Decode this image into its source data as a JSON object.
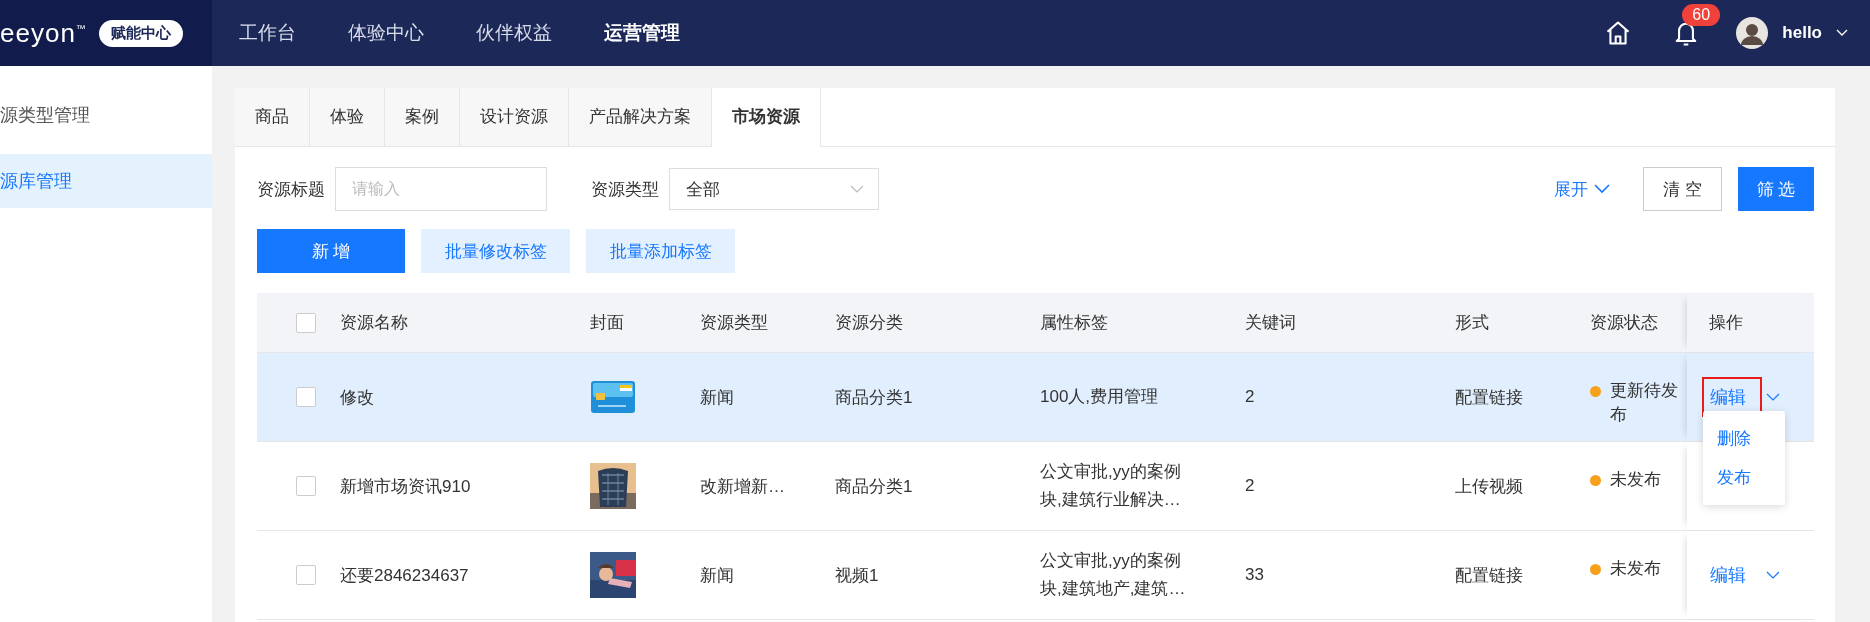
{
  "header": {
    "logo": "eeyon",
    "logo_mark": "™",
    "badge": "赋能中心",
    "nav": [
      {
        "label": "工作台",
        "selected": false
      },
      {
        "label": "体验中心",
        "selected": false
      },
      {
        "label": "伙伴权益",
        "selected": false
      },
      {
        "label": "运营管理",
        "selected": true
      }
    ],
    "notification_count": "60",
    "user": "hello"
  },
  "sidebar": {
    "items": [
      {
        "label": "源类型管理",
        "selected": false
      },
      {
        "label": "源库管理",
        "selected": true
      }
    ]
  },
  "tabs": [
    {
      "label": "商品",
      "selected": false
    },
    {
      "label": "体验",
      "selected": false
    },
    {
      "label": "案例",
      "selected": false
    },
    {
      "label": "设计资源",
      "selected": false
    },
    {
      "label": "产品解决方案",
      "selected": false
    },
    {
      "label": "市场资源",
      "selected": true
    }
  ],
  "filters": {
    "title_label": "资源标题",
    "title_placeholder": "请输入",
    "type_label": "资源类型",
    "type_value": "全部",
    "expand": "展开",
    "clear": "清 空",
    "submit": "筛 选"
  },
  "actions": [
    {
      "label": "新 增",
      "kind": "primary"
    },
    {
      "label": "批量修改标签",
      "kind": "light"
    },
    {
      "label": "批量添加标签",
      "kind": "light"
    }
  ],
  "table": {
    "all_checked": false,
    "columns": [
      "资源名称",
      "封面",
      "资源类型",
      "资源分类",
      "属性标签",
      "关键词",
      "形式",
      "资源状态",
      "操作"
    ],
    "rows": [
      {
        "checked": false,
        "selected": true,
        "name": "修改",
        "cover": {
          "kind": "icon"
        },
        "type": "新闻",
        "category": "商品分类1",
        "tags": "100人,费用管理",
        "keywords": "2",
        "form": "配置链接",
        "status": "更新待发布",
        "color": "#f7a01c",
        "action": {
          "label": "编辑",
          "highlighted": true,
          "menu": [
            "删除",
            "发布"
          ]
        }
      },
      {
        "checked": false,
        "selected": false,
        "name": "新增市场资讯910",
        "type": "改新增新…",
        "category": "商品分类1",
        "tags": "公文审批,yy的案例块,建筑行业解决…",
        "keywords": "2",
        "form": "上传视频",
        "status": "未发布",
        "color": "#f7a01c"
      },
      {
        "checked": false,
        "selected": false,
        "name": "还要2846234637",
        "type": "新闻",
        "category": "视频1",
        "tags": "公文审批,yy的案例块,建筑地产,建筑…",
        "keywords": "33",
        "form": "配置链接",
        "status": "未发布",
        "color": "#f7a01c",
        "action": {
          "label": "编辑",
          "highlighted": false
        }
      }
    ]
  }
}
